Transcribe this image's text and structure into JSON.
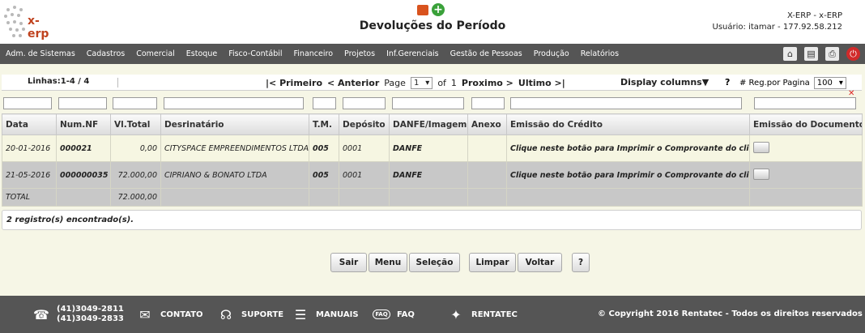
{
  "header": {
    "title": "Devoluções do Período",
    "logo_text": "x-erp",
    "app_name": "X-ERP - x-ERP",
    "user_info": "Usuário: itamar - 177.92.58.212"
  },
  "menu": {
    "items": [
      "Adm. de Sistemas",
      "Cadastros",
      "Comercial",
      "Estoque",
      "Fisco-Contábil",
      "Financeiro",
      "Projetos",
      "Inf.Gerenciais",
      "Gestão de Pessoas",
      "Produção",
      "Relatórios"
    ],
    "icons": [
      "home-icon",
      "document-icon",
      "printer-icon",
      "power-icon"
    ]
  },
  "toolbar": {
    "lines": "Linhas:1-4 / 4",
    "first": "|< Primeiro",
    "previous": "< Anterior",
    "page_label": "Page",
    "page_value": "1",
    "of_label": "of",
    "total_pages": "1",
    "next": "Proximo >",
    "last": "Ultimo >|",
    "display_columns": "Display columns▼",
    "help": "?",
    "reg_label": "# Reg.por Pagina",
    "reg_value": "100"
  },
  "table": {
    "columns": [
      "Data",
      "Num.NF",
      "Vl.Total",
      "Desrinatário",
      "T.M.",
      "Depósito",
      "DANFE/Imagem",
      "Anexo",
      "Emissão do Crédito",
      "Emissão do Documento"
    ],
    "rows": [
      {
        "data": "20-01-2016",
        "num_nf": "000021",
        "vl_total": "0,00",
        "destinatario": "CITYSPACE EMPREENDIMENTOS LTDA.",
        "tm": "005",
        "deposito": "0001",
        "danfe": "DANFE",
        "anexo": "",
        "credito": "Clique neste botão para Imprimir o Comprovante do cliente"
      },
      {
        "data": "21-05-2016",
        "num_nf": "000000035",
        "vl_total": "72.000,00",
        "destinatario": "CIPRIANO & BONATO LTDA",
        "tm": "005",
        "deposito": "0001",
        "danfe": "DANFE",
        "anexo": "",
        "credito": "Clique neste botão para Imprimir o Comprovante do cliente"
      }
    ],
    "total_label": "TOTAL",
    "total_value": "72.000,00"
  },
  "records_found": "2 registro(s) encontrado(s).",
  "buttons": {
    "sair": "Sair",
    "menu": "Menu",
    "selecao": "Seleção",
    "limpar": "Limpar",
    "voltar": "Voltar",
    "help": "?"
  },
  "footer": {
    "phone1": "(41)3049-2811",
    "phone2": "(41)3049-2833",
    "contato": "CONTATO",
    "suporte": "SUPORTE",
    "manuais": "MANUAIS",
    "faq": "FAQ",
    "faq_icon_text": "FAQ",
    "rentatec": "RENTATEC",
    "copyright": "© Copyright 2016 Rentatec - Todos os direitos reservados"
  },
  "colors": {
    "menubar": "#555555",
    "page_bg": "#f6f6e6",
    "link": "#1a2fd0"
  }
}
